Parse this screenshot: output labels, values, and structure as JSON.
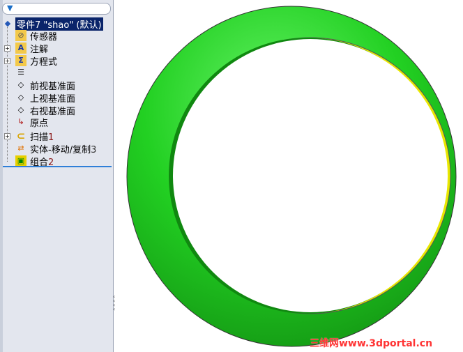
{
  "tree": {
    "root": {
      "label": "零件7 \"shao\" (默认)"
    },
    "items": [
      {
        "label": "传感器",
        "suffix": "",
        "icon": "sensor-folder-icon"
      },
      {
        "label": "注解",
        "suffix": "",
        "icon": "annotation-folder-icon"
      },
      {
        "label": "方程式",
        "suffix": "",
        "icon": "equation-folder-icon"
      },
      {
        "label": "",
        "suffix": "",
        "icon": "material-list-icon"
      },
      {
        "label": "前视基准面",
        "suffix": "",
        "icon": "plane-icon"
      },
      {
        "label": "上视基准面",
        "suffix": "",
        "icon": "plane-icon"
      },
      {
        "label": "右视基准面",
        "suffix": "",
        "icon": "plane-icon"
      },
      {
        "label": "原点",
        "suffix": "",
        "icon": "origin-icon"
      },
      {
        "label": "扫描",
        "suffix": "1",
        "icon": "sweep-icon"
      },
      {
        "label": "实体-移动/复制",
        "suffix": "3",
        "icon": "move-copy-icon"
      },
      {
        "label": "组合",
        "suffix": "2",
        "icon": "combine-icon"
      }
    ]
  },
  "watermark": "三维网www.3dportal.cn",
  "colors": {
    "ring": "#1fd11f",
    "ringSide": "#e8e800",
    "selection": "#0a246a"
  }
}
